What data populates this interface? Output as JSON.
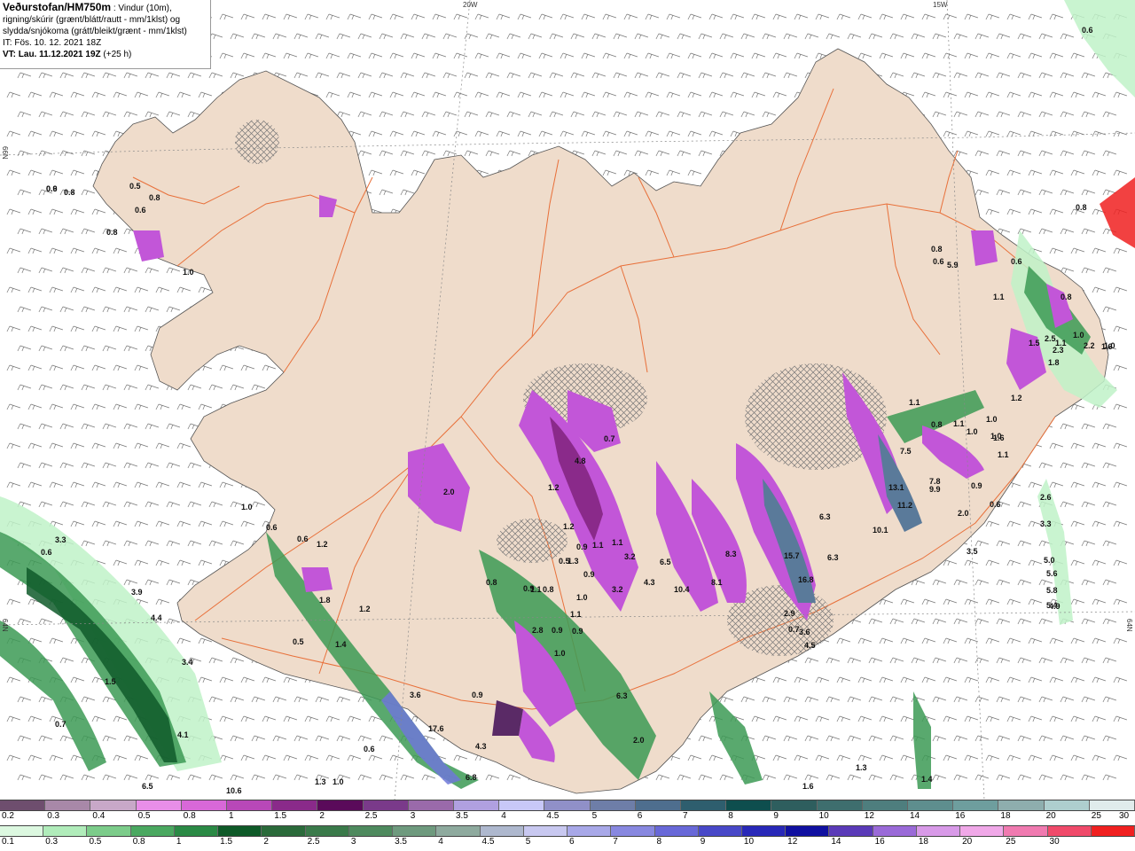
{
  "header": {
    "title": "Veðurstofan/HM750m",
    "desc_line1": ": Vindur (10m),",
    "desc_line2": "rigning/skúrir (grænt/blátt/rautt - mm/1klst) og",
    "desc_line3": "slydda/snjókoma (grátt/bleikt/grænt - mm/1klst)",
    "it_line": "IT: Fös. 10. 12. 2021 18Z",
    "vt_line": "VT: Lau. 11.12.2021 19Z",
    "lead": "(+25 h)"
  },
  "grid_labels": {
    "lon_20w": "20W",
    "lon_15w": "15W",
    "lat_66n_left": "66N",
    "lat_64n_left": "64N",
    "lat_64n_right": "64N"
  },
  "colors": {
    "land": "#efdccb",
    "sea": "#ffffff",
    "roads": "#e8703a",
    "precip_light_green": "#bff2c8",
    "precip_green": "#3c9a55",
    "precip_dark_green": "#0f5a2a",
    "precip_blue": "#6e78d8",
    "snow_magenta": "#c256d8",
    "snow_dark": "#5a2a66",
    "snow_slate": "#5a7a9a"
  },
  "legend_snow": {
    "colors": [
      "#6e4e6e",
      "#a888a8",
      "#c8a8c8",
      "#e88ee8",
      "#d868d8",
      "#b848b8",
      "#8a2a8a",
      "#5a0a5a",
      "#7a3a8a",
      "#9a6aaa",
      "#b0a0e0",
      "#c8c8f8",
      "#9090c8",
      "#6e7ea8",
      "#4e6e8e",
      "#2e5e6e",
      "#0e4e4e",
      "#2e5e5e",
      "#3e6e6e",
      "#4e7e7e",
      "#5e8e8e",
      "#6e9e9e",
      "#8eaeae",
      "#aecece",
      "#e0ecec"
    ],
    "labels": [
      "0.2",
      "0.3",
      "0.4",
      "0.5",
      "0.8",
      "1",
      "1.5",
      "2",
      "2.5",
      "3",
      "3.5",
      "4",
      "4.5",
      "5",
      "6",
      "7",
      "8",
      "9",
      "10",
      "12",
      "14",
      "16",
      "18",
      "20",
      "25",
      "30"
    ]
  },
  "legend_rain": {
    "colors": [
      "#dcf8e0",
      "#b0ecba",
      "#7ccc8a",
      "#4aa860",
      "#2a8a45",
      "#0e5a28",
      "#2a6a3a",
      "#3a7a4a",
      "#4e8a5e",
      "#6e9a7e",
      "#8eaa9e",
      "#aeb8ce",
      "#c8c8f0",
      "#a8a8e8",
      "#8888e0",
      "#6868d8",
      "#4848c8",
      "#2828b8",
      "#1010a0",
      "#5a3ab8",
      "#9a6ad8",
      "#d89ae8",
      "#f0a8e8",
      "#f07ab0",
      "#f04a6a",
      "#f02020"
    ],
    "labels": [
      "0.1",
      "0.3",
      "0.5",
      "0.8",
      "1",
      "1.5",
      "2",
      "2.5",
      "3",
      "3.5",
      "4",
      "4.5",
      "5",
      "6",
      "7",
      "8",
      "9",
      "10",
      "12",
      "14",
      "16",
      "18",
      "20",
      "25",
      "30"
    ]
  },
  "value_labels": [
    "0.6",
    "0.8",
    "0.5",
    "0.8",
    "0.6",
    "1.0",
    "0.8",
    "2.0",
    "1.0",
    "0.6",
    "0.6",
    "1.2",
    "1.8",
    "1.2",
    "0.5",
    "1.4",
    "3.3",
    "0.6",
    "3.9",
    "4.4",
    "1.5",
    "3.4",
    "0.7",
    "4.1",
    "6.5",
    "10.6",
    "0.6",
    "1.3",
    "1.0",
    "3.6",
    "17.6",
    "4.3",
    "6.8",
    "0.9",
    "1.1",
    "0.8",
    "0.9",
    "0.8",
    "0.7",
    "1.1",
    "0.9",
    "2.8",
    "1.0",
    "0.9",
    "4.8",
    "1.2",
    "1.2",
    "0.9",
    "1.1",
    "1.1",
    "0.5",
    "1.3",
    "0.9",
    "1.0",
    "3.2",
    "3.2",
    "4.3",
    "10.4",
    "6.5",
    "6.3",
    "8.3",
    "8.1",
    "15.7",
    "16.8",
    "6.3",
    "2.9",
    "3.6",
    "4.5",
    "0.7",
    "1.1",
    "0.8",
    "1.1",
    "1.0",
    "1.6",
    "1.1",
    "7.5",
    "13.1",
    "11.2",
    "7.8",
    "9.9",
    "10.1",
    "0.9",
    "0.6",
    "2.0",
    "2.6",
    "3.3",
    "5.0",
    "5.6",
    "5.8",
    "5.4",
    "4.9",
    "3.5",
    "1.6",
    "1.0",
    "1.0",
    "1.2",
    "0.8",
    "0.6",
    "0.8",
    "0.6",
    "0.6",
    "1.1",
    "1.0",
    "1.5",
    "2.5",
    "1.8",
    "2.0",
    "6.3",
    "1.6",
    "1.3",
    "1.4",
    "5.9",
    "0.8",
    "1.1",
    "2.2",
    "1.0",
    "2.3",
    "0.9"
  ]
}
